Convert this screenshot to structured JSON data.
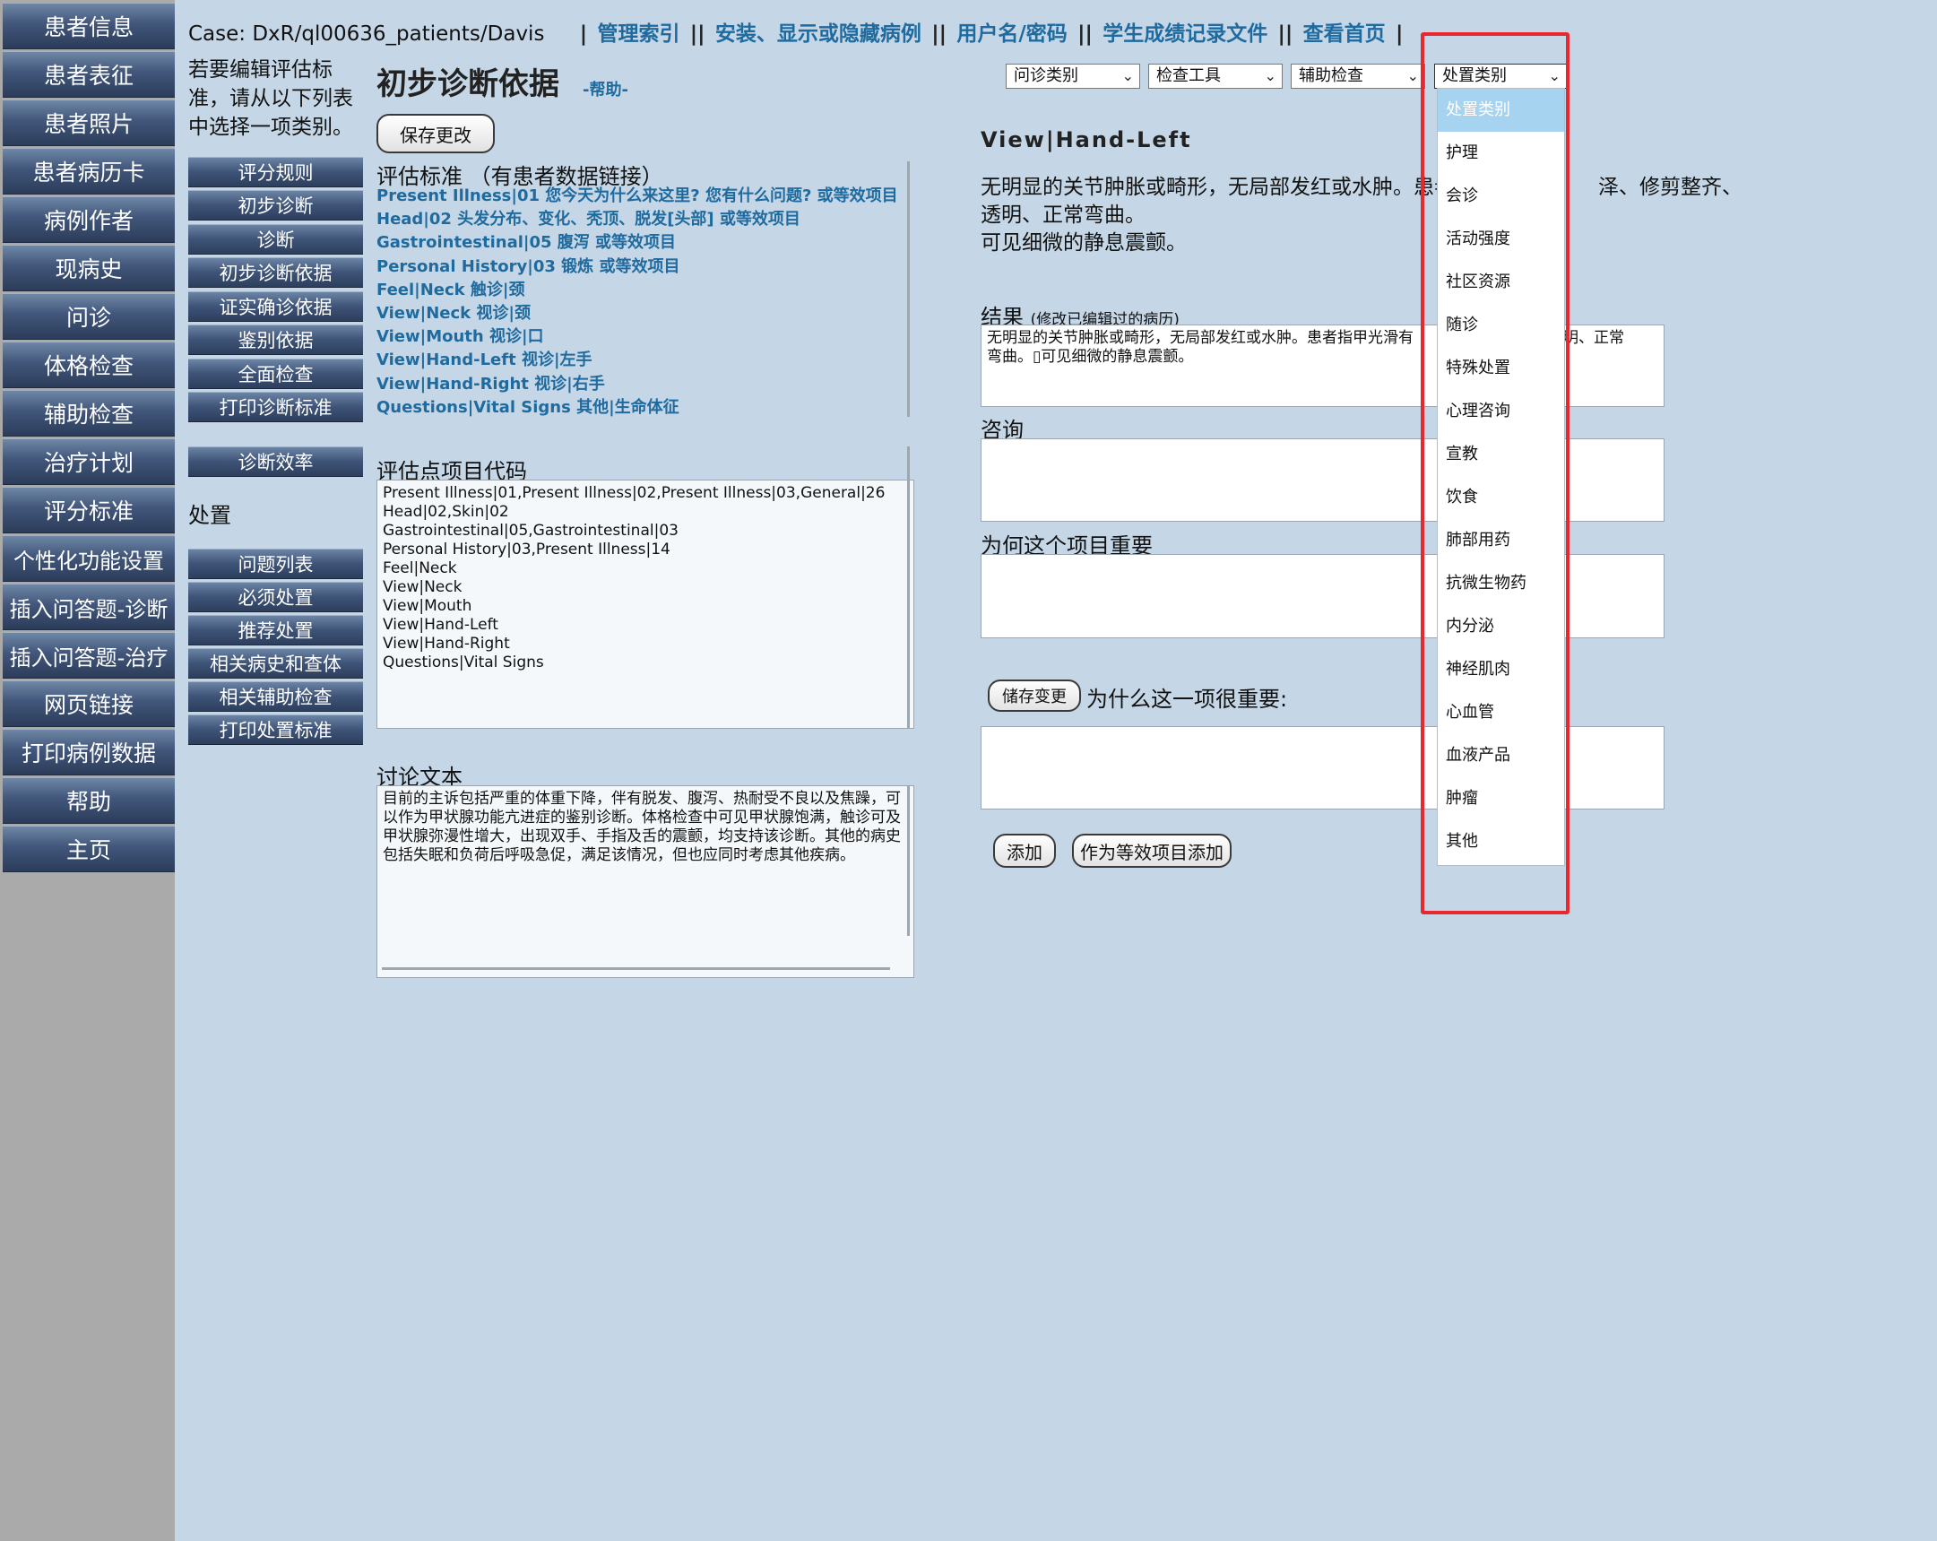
{
  "nav": {
    "items": [
      "患者信息",
      "患者表征",
      "患者照片",
      "患者病历卡",
      "病例作者",
      "现病史",
      "问诊",
      "体格检查",
      "辅助检查",
      "治疗计划",
      "评分标准",
      "个性化功能设置",
      "插入问答题-诊断",
      "插入问答题-治疗",
      "网页链接",
      "打印病例数据",
      "帮助",
      "主页"
    ]
  },
  "header": {
    "case": "Case: DxR/ql00636_patients/Davis",
    "links": [
      "管理索引",
      "安装、显示或隐藏病例",
      "用户名/密码",
      "学生成绩记录文件",
      "查看首页"
    ]
  },
  "instruction": "若要编辑评估标准，请从以下列表中选择一项类别。",
  "mid_buttons": {
    "group1": [
      "评分规则",
      "初步诊断",
      "诊断",
      "初步诊断依据",
      "证实确诊依据",
      "鉴别依据",
      "全面检查",
      "打印诊断标准"
    ],
    "group2": [
      "诊断效率"
    ],
    "group3": [
      "问题列表",
      "必须处置",
      "推荐处置",
      "相关病史和查体",
      "相关辅助检查",
      "打印处置标准"
    ]
  },
  "section_disposal": "处置",
  "page_title": "初步诊断依据",
  "help_link": "-帮助-",
  "save_button": "保存更改",
  "criteria": {
    "heading": "评估标准 （有患者数据链接）",
    "links": [
      "Present Illness|01 您今天为什么来这里?  您有什么问题?   或等效项目",
      "Head|02 头发分布、变化、秃顶、脱发[头部] 或等效项目",
      "Gastrointestinal|05 腹泻 或等效项目",
      "Personal History|03 锻炼 或等效项目",
      "Feel|Neck 触诊|颈",
      "View|Neck 视诊|颈",
      "View|Mouth 视诊|口",
      "View|Hand-Left 视诊|左手",
      "View|Hand-Right 视诊|右手",
      "Questions|Vital Signs 其他|生命体征"
    ]
  },
  "codes": {
    "label": "评估点项目代码",
    "text": "Present Illness|01,Present Illness|02,Present Illness|03,General|26\nHead|02,Skin|02\nGastrointestinal|05,Gastrointestinal|03\nPersonal History|03,Present Illness|14\nFeel|Neck\nView|Neck\nView|Mouth\nView|Hand-Left\nView|Hand-Right\nQuestions|Vital Signs"
  },
  "discussion": {
    "label": "讨论文本",
    "text": "目前的主诉包括严重的体重下降，伴有脱发、腹泻、热耐受不良以及焦躁，可以作为甲状腺功能亢进症的鉴别诊断。体格检查中可见甲状腺饱满，触诊可及甲状腺弥漫性增大，出现双手、手指及舌的震颤，均支持该诊断。其他的病史包括失眠和负荷后呼吸急促，满足该情况，但也应同时考虑其他疾病。"
  },
  "selects": [
    "问诊类别",
    "检查工具",
    "辅助检查",
    "处置类别"
  ],
  "finding": {
    "title": "View|Hand-Left",
    "text_part1": "无明显的关节肿胀或畸形，无局部发红或水肿。患者",
    "text_part2": "泽、修剪整齐、",
    "text_line2": "透明、正常弯曲。",
    "text_line3": "可见细微的静息震颤。"
  },
  "result": {
    "label": "结果",
    "sublabel": "(修改已编辑过的病历)",
    "text_a": "无明显的关节肿胀或畸形，无局部发红或水肿。患者指甲光滑有",
    "text_b": "透明、正常",
    "text_c": "弯曲。▯可见细微的静息震颤。"
  },
  "consult_label": "咨询",
  "why_label": "为何这个项目重要",
  "store_button": "储存变更",
  "why_important_label": "为什么这一项很重要:",
  "add_button": "添加",
  "add_equiv_button": "作为等效项目添加",
  "dropdown": {
    "options": [
      "处置类别",
      "护理",
      "会诊",
      "活动强度",
      "社区资源",
      "随诊",
      "特殊处置",
      "心理咨询",
      "宣教",
      "饮食",
      "肺部用药",
      "抗微生物药",
      "内分泌",
      "神经肌肉",
      "心血管",
      "血液产品",
      "肿瘤",
      "其他"
    ],
    "selected_index": 0
  },
  "colors": {
    "background": "#c5d7e6",
    "link": "#1f6a9e",
    "highlight": "#e8282e",
    "selected_option": "#a6d3ef"
  }
}
